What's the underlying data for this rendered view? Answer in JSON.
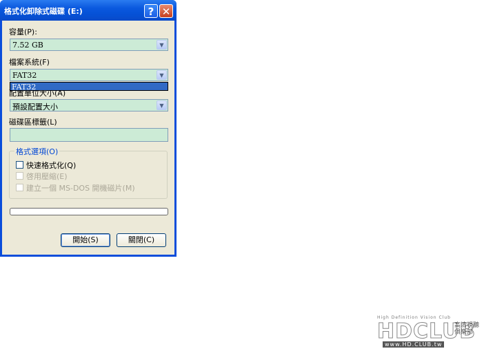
{
  "window": {
    "title": "格式化卸除式磁碟 (E:)",
    "help_glyph": "?",
    "close_glyph": "✕"
  },
  "capacity": {
    "label": "容量(P):",
    "value": "7.52 GB"
  },
  "filesystem": {
    "label": "檔案系統(F)",
    "value": "FAT32",
    "dropdown_option": "FAT32"
  },
  "allocation": {
    "label": "配置單位大小(A)",
    "value": "預設配置大小"
  },
  "volume_label": {
    "label": "磁碟區標籤(L)",
    "value": ""
  },
  "format_options": {
    "title": "格式選項(O)",
    "quick_format": "快速格式化(Q)",
    "enable_compression": "啓用壓縮(E)",
    "create_msdos_disk": "建立一個 MS-DOS 開機磁片(M)"
  },
  "progress": 0,
  "buttons": {
    "start": "開始(S)",
    "close": "關閉(C)"
  },
  "watermark": {
    "tagline": "High Definition Vision Club",
    "brand": "HDCLUB",
    "side": "高清視聽俱樂部",
    "url": "www.HD.CLUB.tw"
  },
  "colors": {
    "titlebar": "#0a58de",
    "field_bg": "#ccebd6",
    "selection": "#316ac5"
  }
}
